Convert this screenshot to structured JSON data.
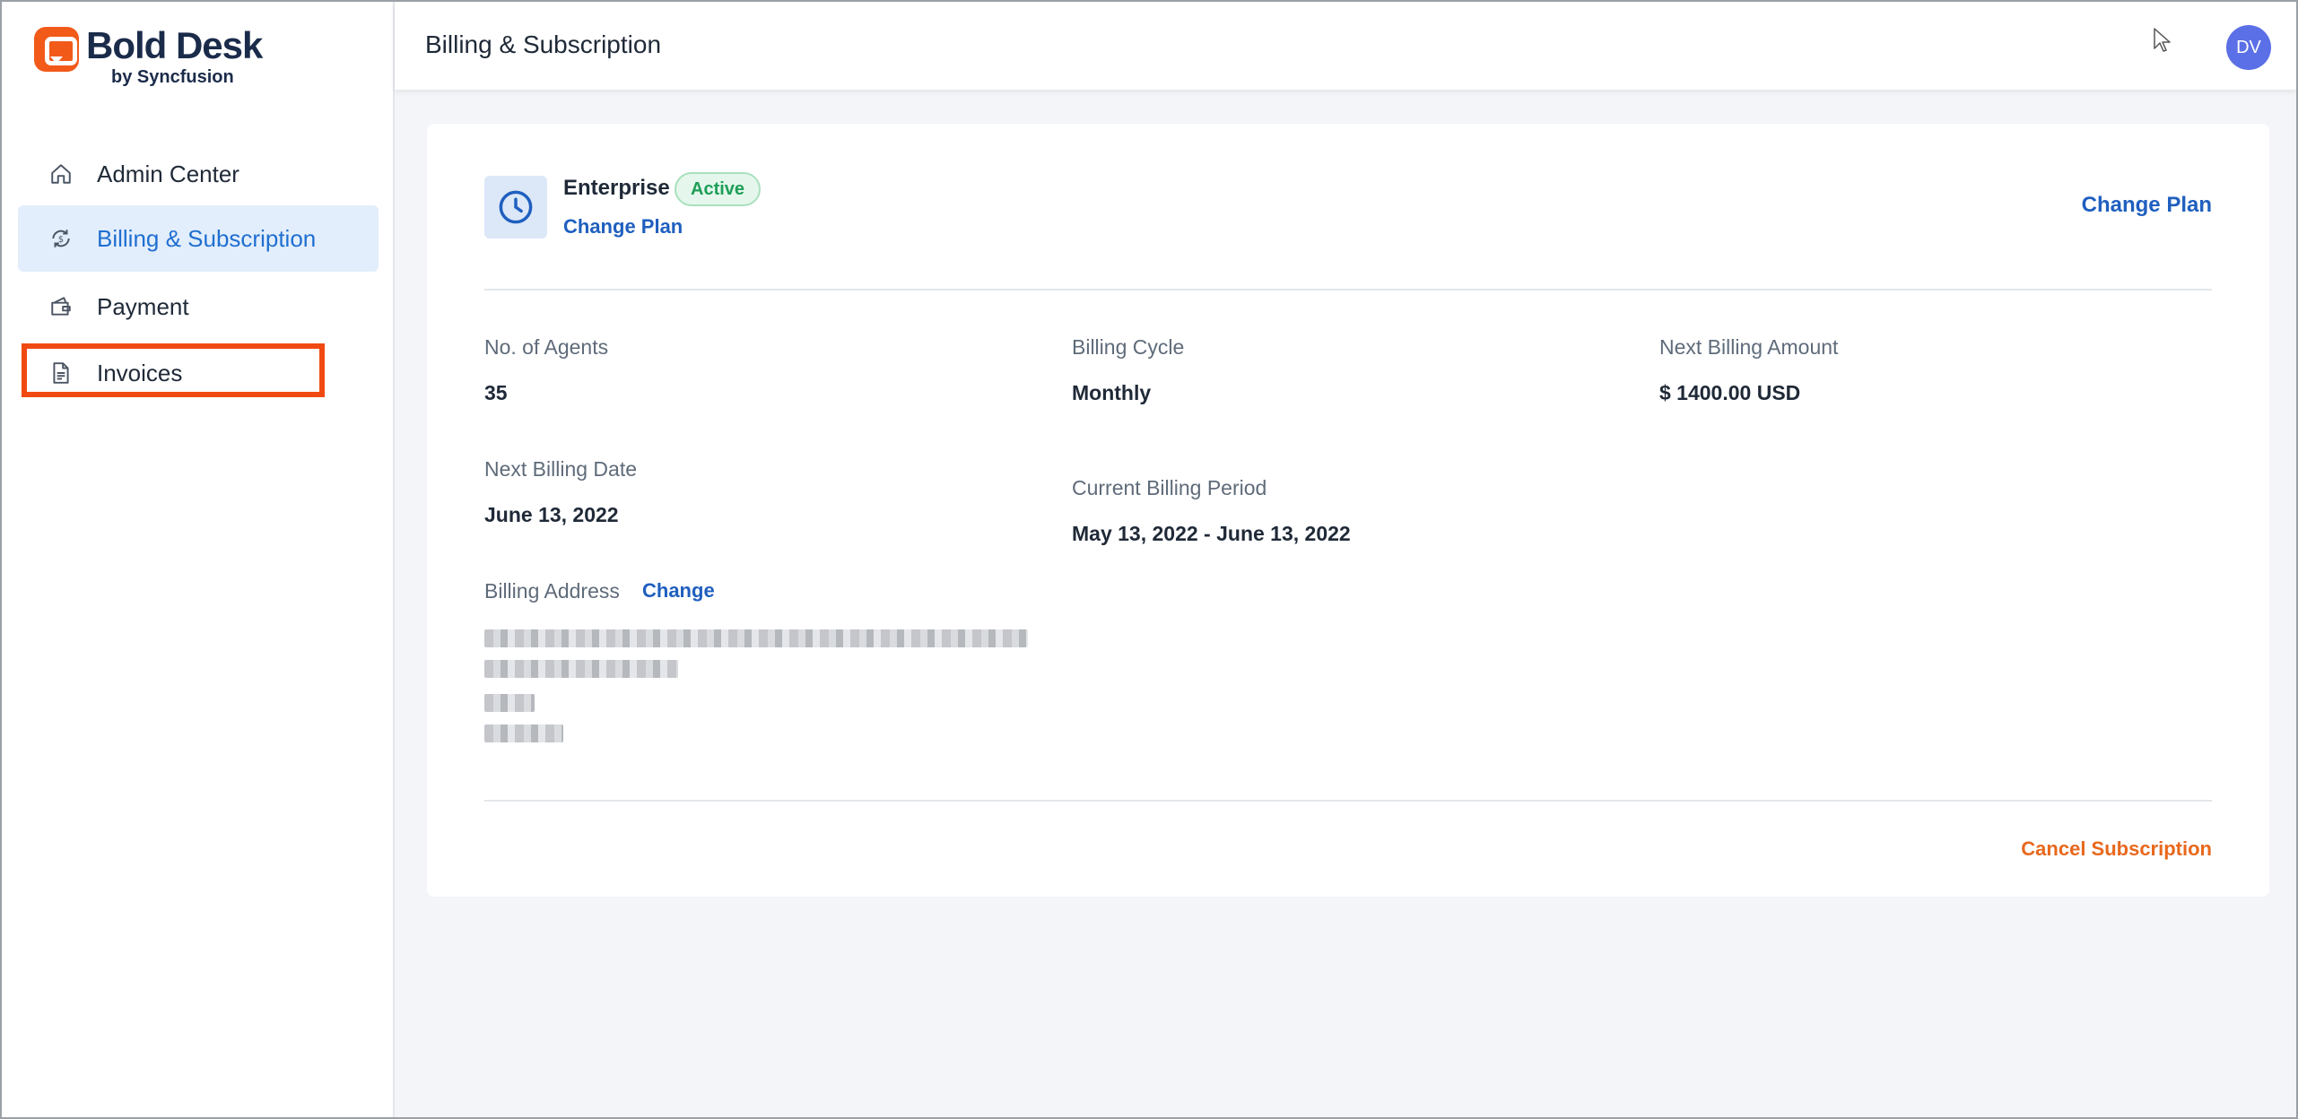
{
  "brand": {
    "name": "Bold Desk",
    "sub": "by Syncfusion",
    "color": "#f25a1a"
  },
  "sidebar": {
    "items": [
      {
        "label": "Admin Center",
        "icon": "home-icon"
      },
      {
        "label": "Billing & Subscription",
        "icon": "billing-icon",
        "active": true
      },
      {
        "label": "Payment",
        "icon": "wallet-icon"
      },
      {
        "label": "Invoices",
        "icon": "document-icon",
        "highlighted": true
      }
    ]
  },
  "header": {
    "title": "Billing & Subscription",
    "avatar_initials": "DV"
  },
  "plan": {
    "name": "Enterprise",
    "status": "Active",
    "change_link": "Change Plan",
    "change_button": "Change Plan"
  },
  "details": {
    "agents_label": "No. of Agents",
    "agents_value": "35",
    "cycle_label": "Billing Cycle",
    "cycle_value": "Monthly",
    "amount_label": "Next Billing Amount",
    "amount_value": "$ 1400.00 USD",
    "next_date_label": "Next Billing Date",
    "next_date_value": "June 13, 2022",
    "period_label": "Current Billing Period",
    "period_value": "May 13, 2022 - June 13, 2022",
    "address_label": "Billing Address",
    "address_change": "Change"
  },
  "footer": {
    "cancel_label": "Cancel Subscription"
  },
  "colors": {
    "accent": "#1f5fbf",
    "active_bg": "#e3eefc",
    "highlight": "#f04a12",
    "cancel": "#e8681c"
  }
}
